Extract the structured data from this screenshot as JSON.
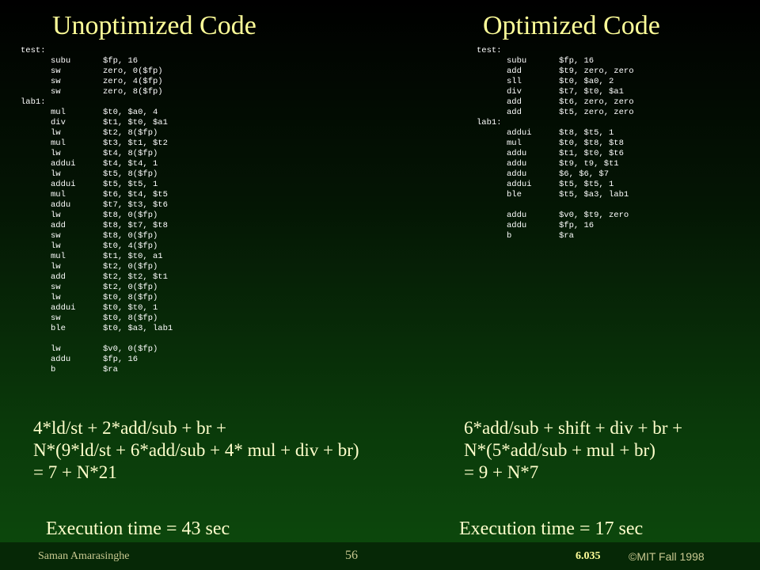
{
  "left": {
    "title": "Unoptimized Code",
    "code": [
      {
        "label": "test:",
        "op": "",
        "args": ""
      },
      {
        "label": "",
        "op": "subu",
        "args": "$fp, 16"
      },
      {
        "label": "",
        "op": "sw",
        "args": "zero, 0($fp)"
      },
      {
        "label": "",
        "op": "sw",
        "args": "zero, 4($fp)"
      },
      {
        "label": "",
        "op": "sw",
        "args": "zero, 8($fp)"
      },
      {
        "label": "lab1:",
        "op": "",
        "args": ""
      },
      {
        "label": "",
        "op": "mul",
        "args": "$t0, $a0, 4"
      },
      {
        "label": "",
        "op": "div",
        "args": "$t1, $t0, $a1"
      },
      {
        "label": "",
        "op": "lw",
        "args": "$t2, 8($fp)"
      },
      {
        "label": "",
        "op": "mul",
        "args": "$t3, $t1, $t2"
      },
      {
        "label": "",
        "op": "lw",
        "args": "$t4, 8($fp)"
      },
      {
        "label": "",
        "op": "addui",
        "args": "$t4, $t4, 1"
      },
      {
        "label": "",
        "op": "lw",
        "args": "$t5, 8($fp)"
      },
      {
        "label": "",
        "op": "addui",
        "args": "$t5, $t5, 1"
      },
      {
        "label": "",
        "op": "mul",
        "args": "$t6, $t4, $t5"
      },
      {
        "label": "",
        "op": "addu",
        "args": "$t7, $t3, $t6"
      },
      {
        "label": "",
        "op": "lw",
        "args": "$t8, 0($fp)"
      },
      {
        "label": "",
        "op": "add",
        "args": "$t8, $t7, $t8"
      },
      {
        "label": "",
        "op": "sw",
        "args": "$t8, 0($fp)"
      },
      {
        "label": "",
        "op": "lw",
        "args": "$t0, 4($fp)"
      },
      {
        "label": "",
        "op": "mul",
        "args": "$t1, $t0, a1"
      },
      {
        "label": "",
        "op": "lw",
        "args": "$t2, 0($fp)"
      },
      {
        "label": "",
        "op": "add",
        "args": "$t2, $t2, $t1"
      },
      {
        "label": "",
        "op": "sw",
        "args": "$t2, 0($fp)"
      },
      {
        "label": "",
        "op": "lw",
        "args": "$t0, 8($fp)"
      },
      {
        "label": "",
        "op": "addui",
        "args": "$t0, $t0, 1"
      },
      {
        "label": "",
        "op": "sw",
        "args": "$t0, 8($fp)"
      },
      {
        "label": "",
        "op": "ble",
        "args": "$t0, $a3, lab1"
      },
      {
        "label": "",
        "op": "",
        "args": ""
      },
      {
        "label": "",
        "op": "lw",
        "args": "$v0, 0($fp)"
      },
      {
        "label": "",
        "op": "addu",
        "args": "$fp, 16"
      },
      {
        "label": "",
        "op": "b",
        "args": "$ra"
      }
    ],
    "summary": [
      "4*ld/st + 2*add/sub + br +",
      "N*(9*ld/st + 6*add/sub + 4* mul + div + br)",
      "= 7 + N*21"
    ],
    "execution": "Execution time = 43 sec"
  },
  "right": {
    "title": "Optimized Code",
    "code": [
      {
        "label": "test:",
        "op": "",
        "args": ""
      },
      {
        "label": "",
        "op": "subu",
        "args": "$fp, 16"
      },
      {
        "label": "",
        "op": "add",
        "args": "$t9, zero, zero"
      },
      {
        "label": "",
        "op": "sll",
        "args": "$t0, $a0, 2"
      },
      {
        "label": "",
        "op": "div",
        "args": "$t7, $t0, $a1"
      },
      {
        "label": "",
        "op": "add",
        "args": "$t6, zero, zero"
      },
      {
        "label": "",
        "op": "add",
        "args": "$t5, zero, zero"
      },
      {
        "label": "lab1:",
        "op": "",
        "args": ""
      },
      {
        "label": "",
        "op": "addui",
        "args": "$t8, $t5, 1"
      },
      {
        "label": "",
        "op": "mul",
        "args": "$t0, $t8, $t8"
      },
      {
        "label": "",
        "op": "addu",
        "args": "$t1, $t0, $t6"
      },
      {
        "label": "",
        "op": "addu",
        "args": "$t9, t9, $t1"
      },
      {
        "label": "",
        "op": "addu",
        "args": "$6, $6, $7"
      },
      {
        "label": "",
        "op": "addui",
        "args": "$t5, $t5, 1"
      },
      {
        "label": "",
        "op": "ble",
        "args": "$t5, $a3, lab1"
      },
      {
        "label": "",
        "op": "",
        "args": ""
      },
      {
        "label": "",
        "op": "addu",
        "args": "$v0, $t9, zero"
      },
      {
        "label": "",
        "op": "addu",
        "args": "$fp, 16"
      },
      {
        "label": "",
        "op": "b",
        "args": "$ra"
      }
    ],
    "summary": [
      "6*add/sub + shift + div + br +",
      "N*(5*add/sub + mul + br)",
      "= 9 + N*7"
    ],
    "execution": "Execution time = 17 sec"
  },
  "footer": {
    "author": "Saman Amarasinghe",
    "page": "56",
    "course": "6.035",
    "copyright": "©MIT Fall 1998"
  }
}
